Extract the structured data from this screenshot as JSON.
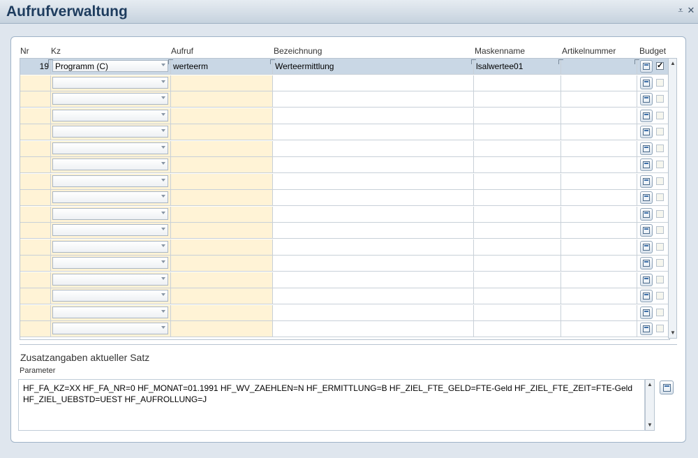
{
  "window": {
    "title": "Aufrufverwaltung",
    "minimize_symbol": "⩡",
    "close_symbol": "✕"
  },
  "columns": {
    "nr": "Nr",
    "kz": "Kz",
    "aufruf": "Aufruf",
    "bezeichnung": "Bezeichnung",
    "maskenname": "Maskenname",
    "artikelnummer": "Artikelnummer",
    "budget": "Budget"
  },
  "rows": [
    {
      "nr": "19",
      "kz": "Programm (C)",
      "aufruf": "werteerm",
      "bezeichnung": "Werteermittlung",
      "maskenname": "lsalwertee01",
      "artikelnummer": "",
      "budget": true
    },
    {
      "nr": "",
      "kz": "",
      "aufruf": "",
      "bezeichnung": "",
      "maskenname": "",
      "artikelnummer": "",
      "budget": false
    },
    {
      "nr": "",
      "kz": "",
      "aufruf": "",
      "bezeichnung": "",
      "maskenname": "",
      "artikelnummer": "",
      "budget": false
    },
    {
      "nr": "",
      "kz": "",
      "aufruf": "",
      "bezeichnung": "",
      "maskenname": "",
      "artikelnummer": "",
      "budget": false
    },
    {
      "nr": "",
      "kz": "",
      "aufruf": "",
      "bezeichnung": "",
      "maskenname": "",
      "artikelnummer": "",
      "budget": false
    },
    {
      "nr": "",
      "kz": "",
      "aufruf": "",
      "bezeichnung": "",
      "maskenname": "",
      "artikelnummer": "",
      "budget": false
    },
    {
      "nr": "",
      "kz": "",
      "aufruf": "",
      "bezeichnung": "",
      "maskenname": "",
      "artikelnummer": "",
      "budget": false
    },
    {
      "nr": "",
      "kz": "",
      "aufruf": "",
      "bezeichnung": "",
      "maskenname": "",
      "artikelnummer": "",
      "budget": false
    },
    {
      "nr": "",
      "kz": "",
      "aufruf": "",
      "bezeichnung": "",
      "maskenname": "",
      "artikelnummer": "",
      "budget": false
    },
    {
      "nr": "",
      "kz": "",
      "aufruf": "",
      "bezeichnung": "",
      "maskenname": "",
      "artikelnummer": "",
      "budget": false
    },
    {
      "nr": "",
      "kz": "",
      "aufruf": "",
      "bezeichnung": "",
      "maskenname": "",
      "artikelnummer": "",
      "budget": false
    },
    {
      "nr": "",
      "kz": "",
      "aufruf": "",
      "bezeichnung": "",
      "maskenname": "",
      "artikelnummer": "",
      "budget": false
    },
    {
      "nr": "",
      "kz": "",
      "aufruf": "",
      "bezeichnung": "",
      "maskenname": "",
      "artikelnummer": "",
      "budget": false
    },
    {
      "nr": "",
      "kz": "",
      "aufruf": "",
      "bezeichnung": "",
      "maskenname": "",
      "artikelnummer": "",
      "budget": false
    },
    {
      "nr": "",
      "kz": "",
      "aufruf": "",
      "bezeichnung": "",
      "maskenname": "",
      "artikelnummer": "",
      "budget": false
    },
    {
      "nr": "",
      "kz": "",
      "aufruf": "",
      "bezeichnung": "",
      "maskenname": "",
      "artikelnummer": "",
      "budget": false
    },
    {
      "nr": "",
      "kz": "",
      "aufruf": "",
      "bezeichnung": "",
      "maskenname": "",
      "artikelnummer": "",
      "budget": false
    }
  ],
  "details": {
    "section_title": "Zusatzangaben aktueller Satz",
    "parameter_label": "Parameter",
    "parameter_value": "HF_FA_KZ=XX HF_FA_NR=0 HF_MONAT=01.1991 HF_WV_ZAEHLEN=N HF_ERMITTLUNG=B HF_ZIEL_FTE_GELD=FTE-Geld HF_ZIEL_FTE_ZEIT=FTE-Geld HF_ZIEL_UEBSTD=UEST HF_AUFROLLUNG=J"
  },
  "colors": {
    "required_cell": "#fff3d6",
    "selected_row": "#c9d7e5",
    "title_text": "#1e3c5e"
  },
  "icons": {
    "row_action": "edit-form-icon",
    "parameter_action": "edit-form-icon"
  }
}
